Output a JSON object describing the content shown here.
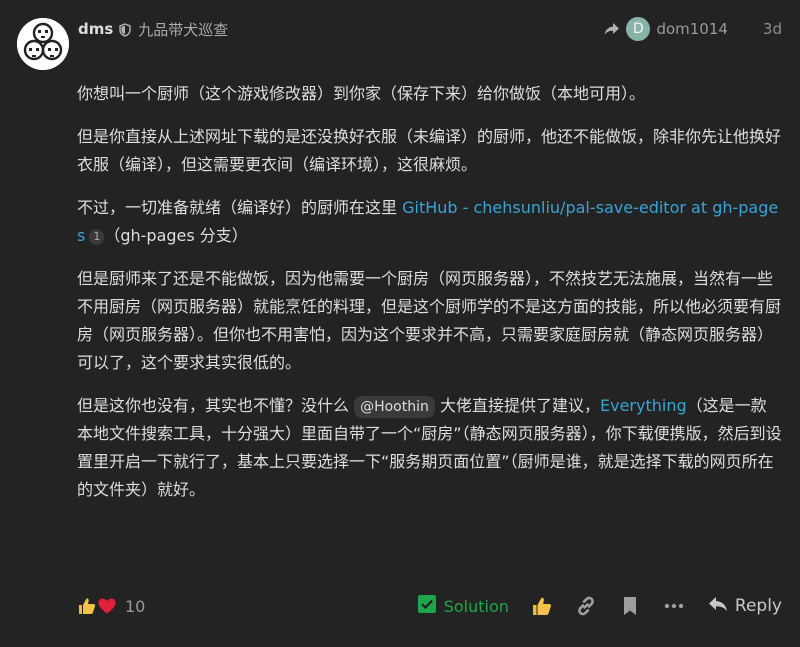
{
  "header": {
    "username": "dms",
    "flair": "九品带犬巡查",
    "reply_to_initial": "D",
    "reply_to_user": "dom1014",
    "date": "3d"
  },
  "body": {
    "p1": "你想叫一个厨师（这个游戏修改器）到你家（保存下来）给你做饭（本地可用）。",
    "p2": "但是你直接从上述网址下载的是还没换好衣服（未编译）的厨师，他还不能做饭，除非你先让他换好衣服（编译），但这需要更衣间（编译环境），这很麻烦。",
    "p3_before": "不过，一切准备就绪（编译好）的厨师在这里 ",
    "p3_link": "GitHub - chehsunliu/pal-save-editor at gh-pages",
    "p3_clicks": "1",
    "p3_after": "（gh-pages 分支）",
    "p4": "但是厨师来了还是不能做饭，因为他需要一个厨房（网页服务器），不然技艺无法施展，当然有一些不用厨房（网页服务器）就能烹饪的料理，但是这个厨师学的不是这方面的技能，所以他必须要有厨房（网页服务器）。但你也不用害怕，因为这个要求并不高，只需要家庭厨房就（静态网页服务器）可以了，这个要求其实很低的。",
    "p5_before": "但是这你也没有，其实也不懂？没什么 ",
    "p5_mention": "@Hoothin",
    "p5_middle": " 大佬直接提供了建议，",
    "p5_link": "Everything",
    "p5_after": "（这是一款本地文件搜索工具，十分强大）里面自带了一个“厨房”（静态网页服务器），你下载便携版，然后到设置里开启一下就行了，基本上只要选择一下“服务期页面位置”（厨师是谁，就是选择下载的网页所在的文件夹）就好。"
  },
  "actions": {
    "like_count": "10",
    "solution_label": "Solution",
    "reply_label": "Reply"
  },
  "colors": {
    "background": "#232323",
    "link": "#3aa3d6",
    "solution": "#1ea64a",
    "reply_avatar": "#87b3a8"
  },
  "icons": {
    "shield": "shield-icon",
    "reply_arrow": "reply-arrow-icon",
    "thumbs_up": "thumbs-up-icon",
    "heart": "heart-icon",
    "checkbox": "check-square-icon",
    "link": "link-icon",
    "bookmark": "bookmark-icon",
    "more": "ellipsis-icon",
    "reply": "reply-icon"
  }
}
